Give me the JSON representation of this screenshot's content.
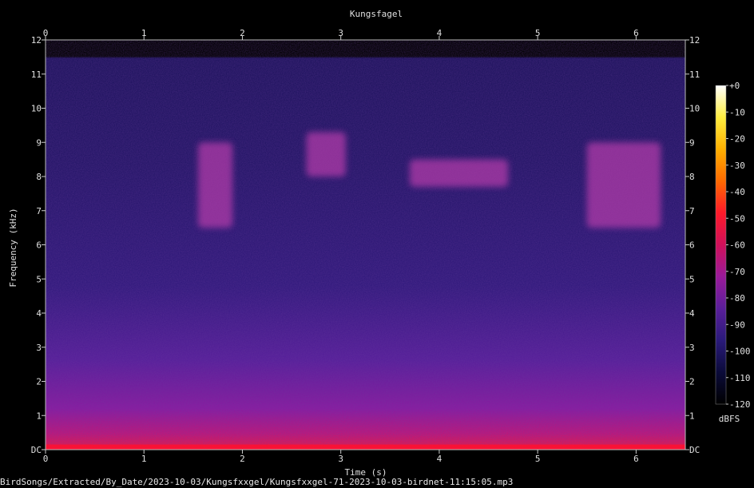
{
  "chart_data": {
    "type": "heatmap",
    "title": "Kungsfagel",
    "xlabel": "Time (s)",
    "ylabel": "Frequency (kHz)",
    "xlim": [
      0,
      6.5
    ],
    "ylim": [
      0,
      12
    ],
    "x_ticks": [
      "0",
      "1",
      "2",
      "3",
      "4",
      "5",
      "6"
    ],
    "y_ticks": [
      "DC",
      "1",
      "2",
      "3",
      "4",
      "5",
      "6",
      "7",
      "8",
      "9",
      "10",
      "11",
      "12"
    ],
    "colorbar": {
      "label": "dBFS",
      "range": [
        -120,
        0
      ],
      "ticks": [
        "+0",
        "-10",
        "-20",
        "-30",
        "-40",
        "-50",
        "-60",
        "-70",
        "-80",
        "-90",
        "-100",
        "-110",
        "-120"
      ],
      "colors": [
        "#000000",
        "#0b0b3a",
        "#2a1a7a",
        "#5a1e9a",
        "#9a1a9a",
        "#d0105a",
        "#ff1a2a",
        "#ff6a00",
        "#ffb000",
        "#ffee40",
        "#ffffff"
      ]
    },
    "signal_ceiling_khz": 11.5,
    "calls": [
      {
        "t_start": 1.55,
        "t_end": 1.9,
        "f_low": 6.5,
        "f_high": 9.0
      },
      {
        "t_start": 2.65,
        "t_end": 3.05,
        "f_low": 8.0,
        "f_high": 9.3
      },
      {
        "t_start": 3.7,
        "t_end": 4.7,
        "f_low": 7.7,
        "f_high": 8.5
      },
      {
        "t_start": 5.5,
        "t_end": 6.25,
        "f_low": 6.5,
        "f_high": 9.0
      }
    ]
  },
  "footer": "BirdSongs/Extracted/By_Date/2023-10-03/Kungsfxxgel/Kungsfxxgel-71-2023-10-03-birdnet-11:15:05.mp3"
}
